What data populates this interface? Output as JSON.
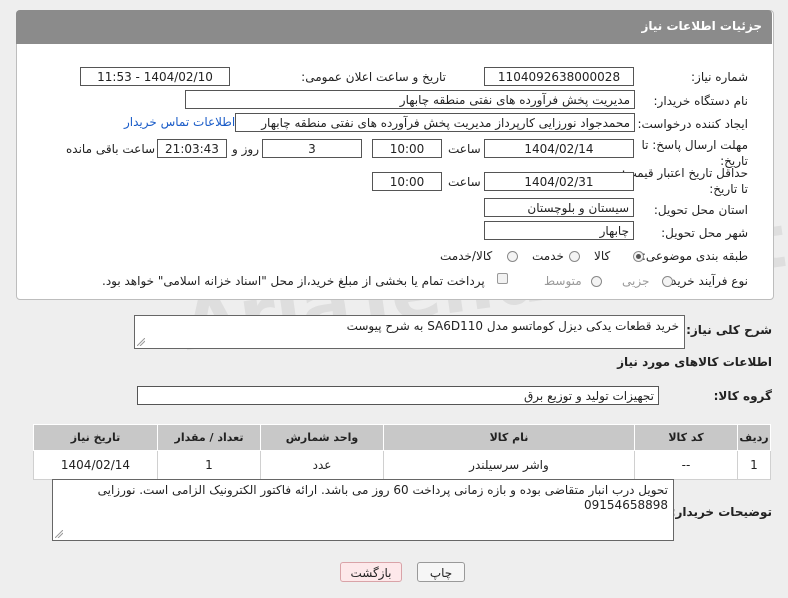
{
  "header": {
    "title": "جزئیات اطلاعات نیاز"
  },
  "form": {
    "need_number_label": "شماره نیاز:",
    "need_number": "1104092638000028",
    "announce_label": "تاریخ و ساعت اعلان عمومی:",
    "announce_value": "1404/02/10 - 11:53",
    "buyer_org_label": "نام دستگاه خریدار:",
    "buyer_org": "مدیریت پخش فرآورده های نفتی منطقه چابهار",
    "creator_label": "ایجاد کننده درخواست:",
    "creator": "محمدجواد نورزایی کارپرداز مدیریت پخش فرآورده های نفتی منطقه چابهار",
    "contact_link": "اطلاعات تماس خریدار",
    "deadline_label": "مهلت ارسال پاسخ: تا تاریخ:",
    "deadline_date": "1404/02/14",
    "time_label": "ساعت",
    "deadline_time": "10:00",
    "days_value": "3",
    "days_label": "روز و",
    "remaining_time": "21:03:43",
    "remaining_label": "ساعت باقی مانده",
    "validity_label": "حداقل تاریخ اعتبار قیمت: تا تاریخ:",
    "validity_date": "1404/02/31",
    "validity_time": "10:00",
    "province_label": "استان محل تحویل:",
    "province": "سیستان و بلوچستان",
    "city_label": "شهر محل تحویل:",
    "city": "چابهار",
    "category_label": "طبقه بندی موضوعی:",
    "category_options": [
      "کالا",
      "خدمت",
      "کالا/خدمت"
    ],
    "process_label": "نوع فرآیند خرید :",
    "process_options": [
      "جزیی",
      "متوسط"
    ],
    "payment_note": "پرداخت تمام یا بخشی از مبلغ خرید،از محل \"اسناد خزانه اسلامی\" خواهد بود."
  },
  "summary": {
    "label": "شرح کلی نیاز:",
    "value": "خرید قطعات یدکی دیزل کوماتسو مدل SA6D110  به شرح پیوست"
  },
  "goods": {
    "section_title": "اطلاعات کالاهای مورد نیاز",
    "group_label": "گروه کالا:",
    "group_value": "تجهیزات تولید و توزیع برق"
  },
  "table": {
    "columns": [
      "ردیف",
      "کد کالا",
      "نام کالا",
      "واحد شمارش",
      "تعداد / مقدار",
      "تاریخ نیاز"
    ],
    "rows": [
      [
        "1",
        "--",
        "واشر سرسیلندر",
        "عدد",
        "1",
        "1404/02/14"
      ]
    ]
  },
  "buyer_notes": {
    "label": "توضیحات خریدار:",
    "value": "تحویل درب انبار متقاضی بوده و بازه زمانی پرداخت 60 روز می باشد. ارائه فاکتور الکترونیک الزامی است. نورزایی 09154658898"
  },
  "buttons": {
    "print": "چاپ",
    "back": "بازگشت"
  },
  "watermark": "AriaTender.net",
  "colors": {
    "header_bg": "#8b8b8b",
    "link": "#1a5cc8",
    "back_button_bg": "#fde8ea"
  }
}
